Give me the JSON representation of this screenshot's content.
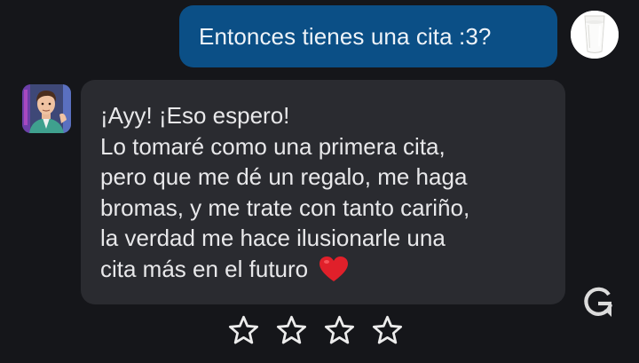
{
  "conversation": {
    "user_message": {
      "text": "Entonces tienes una cita :3?",
      "avatar_icon": "glass-of-milk-avatar"
    },
    "bot_message": {
      "avatar_icon": "character-avatar",
      "lines": [
        "¡Ayy! ¡Eso espero!",
        "Lo tomaré como una primera cita,",
        "pero que me dé un regalo, me haga",
        "bromas, y me trate con tanto cariño,",
        "la verdad me hace ilusionarle una",
        "cita más en el futuro"
      ],
      "trailing_emoji": "red-heart-icon"
    }
  },
  "actions": {
    "regenerate_icon": "regenerate-icon",
    "rating": {
      "max_stars": 4,
      "selected": 0
    }
  },
  "colors": {
    "background": "#15161a",
    "user_bubble": "#0b4f86",
    "bot_bubble": "#2a2b30",
    "text": "#e8e8ea",
    "heart": "#e0202a"
  }
}
